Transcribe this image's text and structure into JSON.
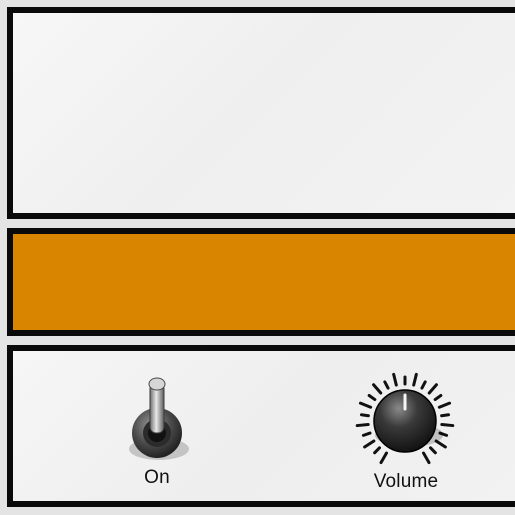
{
  "colors": {
    "panel_border": "#0a0a0a",
    "panel_face": "#f2f2f2",
    "stripe": "#d98500",
    "knob": "#2a2a2a"
  },
  "controls": {
    "power_toggle": {
      "label": "On",
      "icon": "toggle-switch-icon"
    },
    "volume_knob": {
      "label": "Volume",
      "icon": "rotary-knob-icon"
    }
  }
}
